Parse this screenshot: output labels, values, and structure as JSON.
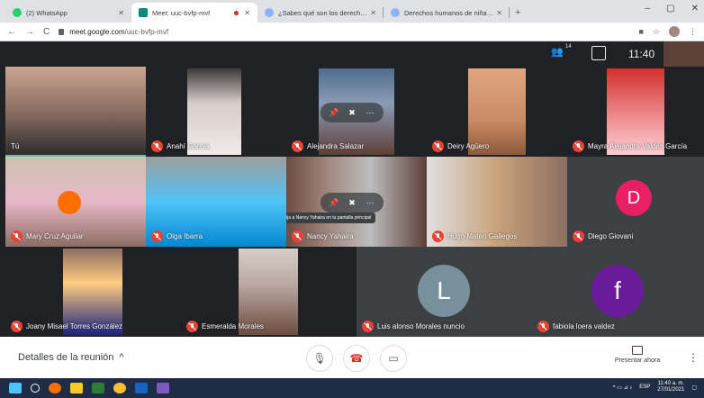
{
  "browser": {
    "tabs": [
      {
        "label": "(2) WhatsApp",
        "icon": "whatsapp-icon",
        "color": "#25d366",
        "active": false
      },
      {
        "label": "Meet: uuc-bvfp-mvf",
        "icon": "meet-icon",
        "color": "#00897b",
        "active": true
      },
      {
        "label": "¿Sabes qué son los derechos de",
        "icon": "web-icon",
        "color": "#8ab4f8",
        "active": false
      },
      {
        "label": "Derechos humanos de niñas y n",
        "icon": "web-icon",
        "color": "#8ab4f8",
        "active": false
      }
    ],
    "new_tab": "+",
    "window_controls": [
      "–",
      "▢",
      "✕"
    ],
    "url_host": "meet.google.com",
    "url_path": "/uuc-bvfp-mvf"
  },
  "meet": {
    "participant_count": "14",
    "clock": "11:40",
    "tiles": [
      {
        "name": "Tú",
        "muted": false
      },
      {
        "name": "Anahí García",
        "muted": true
      },
      {
        "name": "Alejandra Salazar",
        "muted": true
      },
      {
        "name": "Deiry Agüero",
        "muted": true
      },
      {
        "name": "Mayra Alejandra Valdés García",
        "muted": true
      },
      {
        "name": "Mary Cruz Aguilar",
        "muted": true
      },
      {
        "name": "Olga Ibarra",
        "muted": true
      },
      {
        "name": "Nancy Yahaira",
        "muted": true
      },
      {
        "name": "Hugo Mateo Gallegos",
        "muted": true
      },
      {
        "name": "Diego Giovani",
        "muted": true,
        "letter": "D",
        "avatar_color": "#e91e63"
      },
      {
        "name": "Joany Misael Torres González",
        "muted": true
      },
      {
        "name": "Esmeralda Morales",
        "muted": true
      },
      {
        "name": "Luis alonso Morales nuncio",
        "muted": true,
        "letter": "L",
        "avatar_color": "#78909c"
      },
      {
        "name": "fabiola loera valdez",
        "muted": true,
        "letter": "f",
        "avatar_color": "#6a1b9a"
      }
    ],
    "tooltip": "Fija a Nancy Yahaira en tu pantalla principal"
  },
  "bottom": {
    "details_label": "Detalles de la reunión",
    "present_label": "Presentar ahora"
  },
  "taskbar": {
    "lang": "ESP",
    "time": "11:40 a. m.",
    "date": "27/01/2021"
  }
}
